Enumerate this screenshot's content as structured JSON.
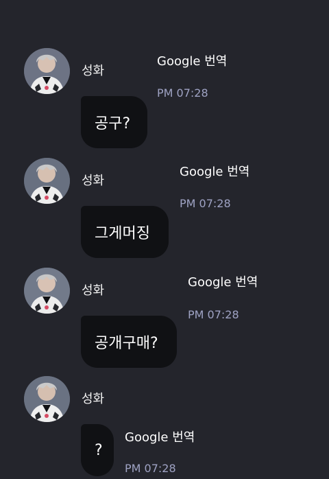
{
  "chat": {
    "messages": [
      {
        "sender": "성화",
        "text": "공구?",
        "translate_label": "Google 번역",
        "time": "PM 07:28",
        "avatar_icon": "profile-photo-icon"
      },
      {
        "sender": "성화",
        "text": "그게머징",
        "translate_label": "Google 번역",
        "time": "PM 07:28",
        "avatar_icon": "profile-photo-icon"
      },
      {
        "sender": "성화",
        "text": "공개구매?",
        "translate_label": "Google 번역",
        "time": "PM 07:28",
        "avatar_icon": "profile-photo-icon"
      },
      {
        "sender": "성화",
        "text": "?",
        "translate_label": "Google 번역",
        "time": "PM 07:28",
        "avatar_icon": "profile-photo-icon"
      }
    ]
  },
  "colors": {
    "background": "#24252c",
    "bubble": "#101114",
    "time": "#9fa3c4",
    "text": "#ffffff"
  }
}
